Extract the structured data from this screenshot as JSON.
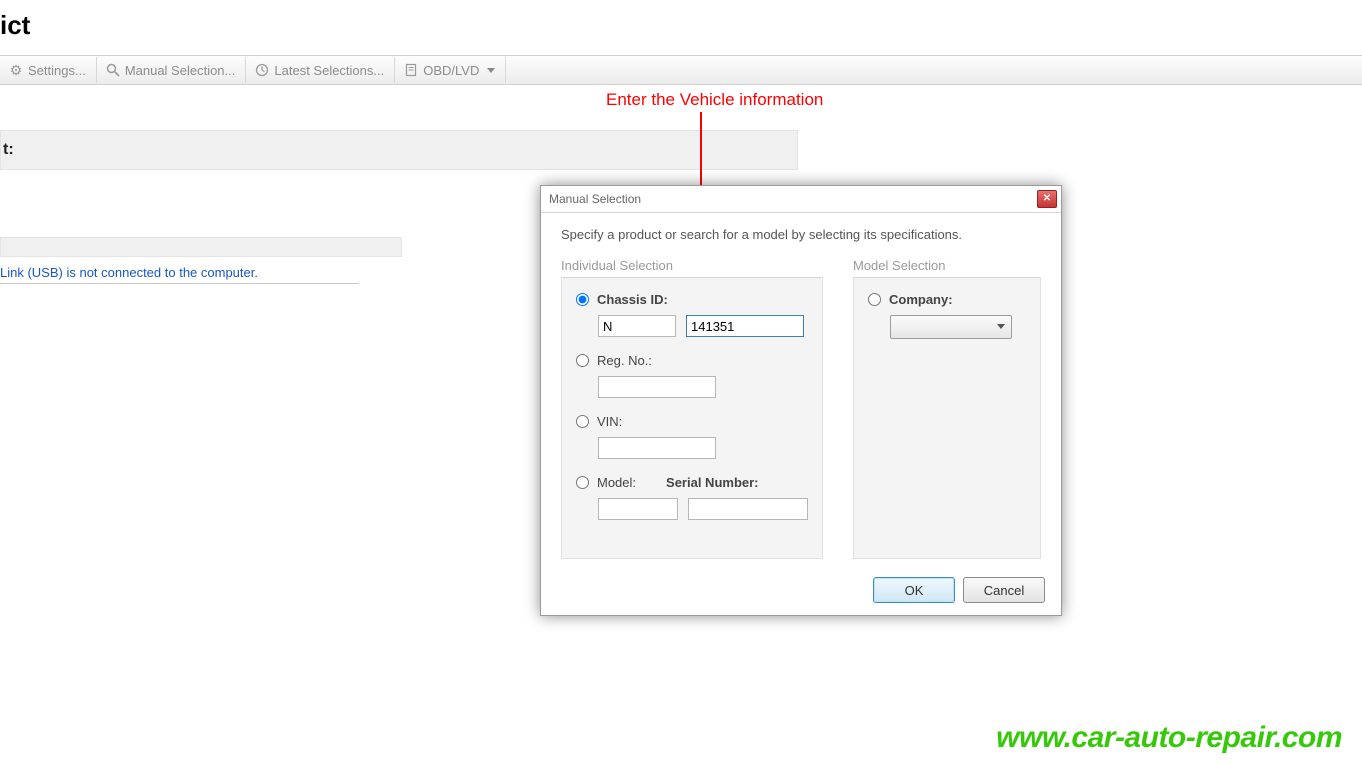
{
  "page": {
    "title_fragment": "ict"
  },
  "toolbar": {
    "settings": "Settings...",
    "manual_selection": "Manual Selection...",
    "latest_selections": "Latest Selections...",
    "obd_lvd": "OBD/LVD"
  },
  "info": {
    "label_fragment": "t:"
  },
  "status": {
    "message": "Link (USB) is not connected to the computer."
  },
  "dialog": {
    "title": "Manual Selection",
    "instruction": "Specify a product or search for a model by selecting its specifications.",
    "individual_selection_title": "Individual Selection",
    "model_selection_title": "Model Selection",
    "chassis_id_label": "Chassis ID:",
    "chassis_prefix_value": "N",
    "chassis_number_value": "141351",
    "reg_no_label": "Reg. No.:",
    "reg_no_value": "",
    "vin_label": "VIN:",
    "vin_value": "",
    "model_label": "Model:",
    "serial_label": "Serial Number:",
    "model_value": "",
    "serial_value": "",
    "company_label": "Company:",
    "ok_label": "OK",
    "cancel_label": "Cancel"
  },
  "annotation": {
    "text": "Enter the Vehicle information"
  },
  "watermark": {
    "text": "www.car-auto-repair.com"
  }
}
